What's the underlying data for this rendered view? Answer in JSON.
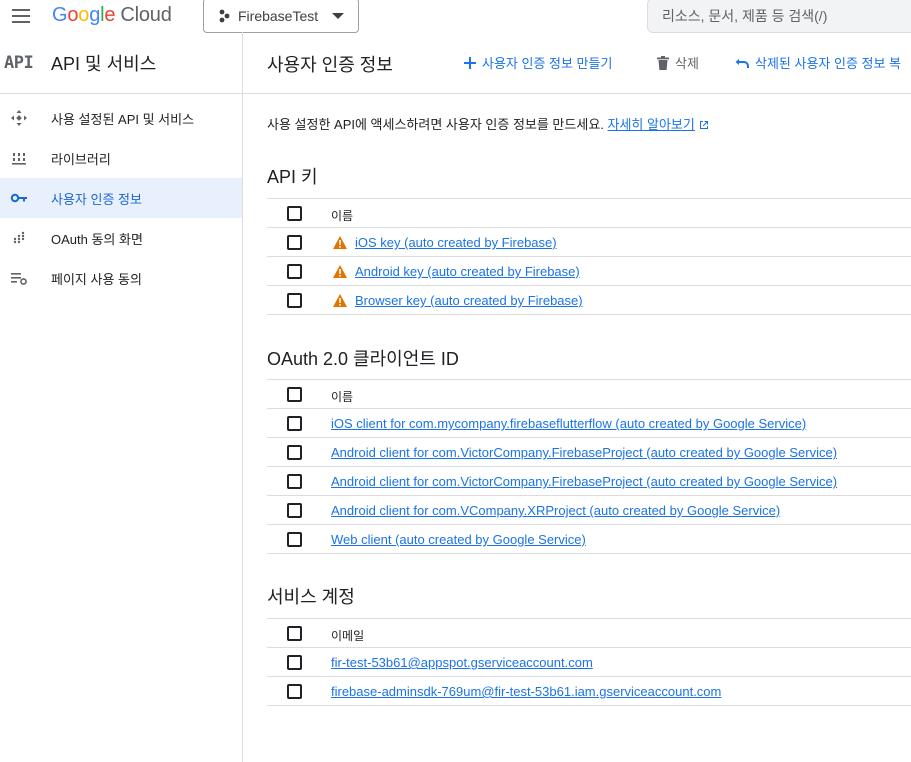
{
  "topbar": {
    "logo_google": "Google",
    "logo_cloud": "Cloud",
    "project_name": "FirebaseTest",
    "search_placeholder": "리소스, 문서, 제품 등 검색(/)"
  },
  "sidebar": {
    "badge": "API",
    "title": "API 및 서비스",
    "items": [
      {
        "label": "사용 설정된 API 및 서비스",
        "icon": "diamond-arrows-icon"
      },
      {
        "label": "라이브러리",
        "icon": "library-icon"
      },
      {
        "label": "사용자 인증 정보",
        "icon": "key-icon"
      },
      {
        "label": "OAuth 동의 화면",
        "icon": "dots-grid-icon"
      },
      {
        "label": "페이지 사용 동의",
        "icon": "settings-list-icon"
      }
    ],
    "active_index": 2
  },
  "header": {
    "title": "사용자 인증 정보",
    "create_label": "사용자 인증 정보 만들기",
    "delete_label": "삭제",
    "restore_label": "삭제된 사용자 인증 정보 복"
  },
  "intro": {
    "text": "사용 설정한 API에 액세스하려면 사용자 인증 정보를 만드세요.",
    "link": "자세히 알아보기"
  },
  "api_keys": {
    "title": "API 키",
    "header": "이름",
    "rows": [
      "iOS key (auto created by Firebase)",
      "Android key (auto created by Firebase)",
      "Browser key (auto created by Firebase)"
    ]
  },
  "oauth": {
    "title": "OAuth 2.0 클라이언트 ID",
    "header": "이름",
    "rows": [
      "iOS client for com.mycompany.firebaseflutterflow (auto created by Google Service)",
      "Android client for com.VictorCompany.FirebaseProject (auto created by Google Service)",
      "Android client for com.VictorCompany.FirebaseProject (auto created by Google Service)",
      "Android client for com.VCompany.XRProject (auto created by Google Service)",
      "Web client (auto created by Google Service)"
    ]
  },
  "service_accounts": {
    "title": "서비스 계정",
    "header": "이메일",
    "rows": [
      "fir-test-53b61@appspot.gserviceaccount.com",
      "firebase-adminsdk-769um@fir-test-53b61.iam.gserviceaccount.com"
    ]
  },
  "colors": {
    "link": "#1a73e8",
    "active_bg": "#e8f0fe",
    "warning": "#e37400"
  }
}
